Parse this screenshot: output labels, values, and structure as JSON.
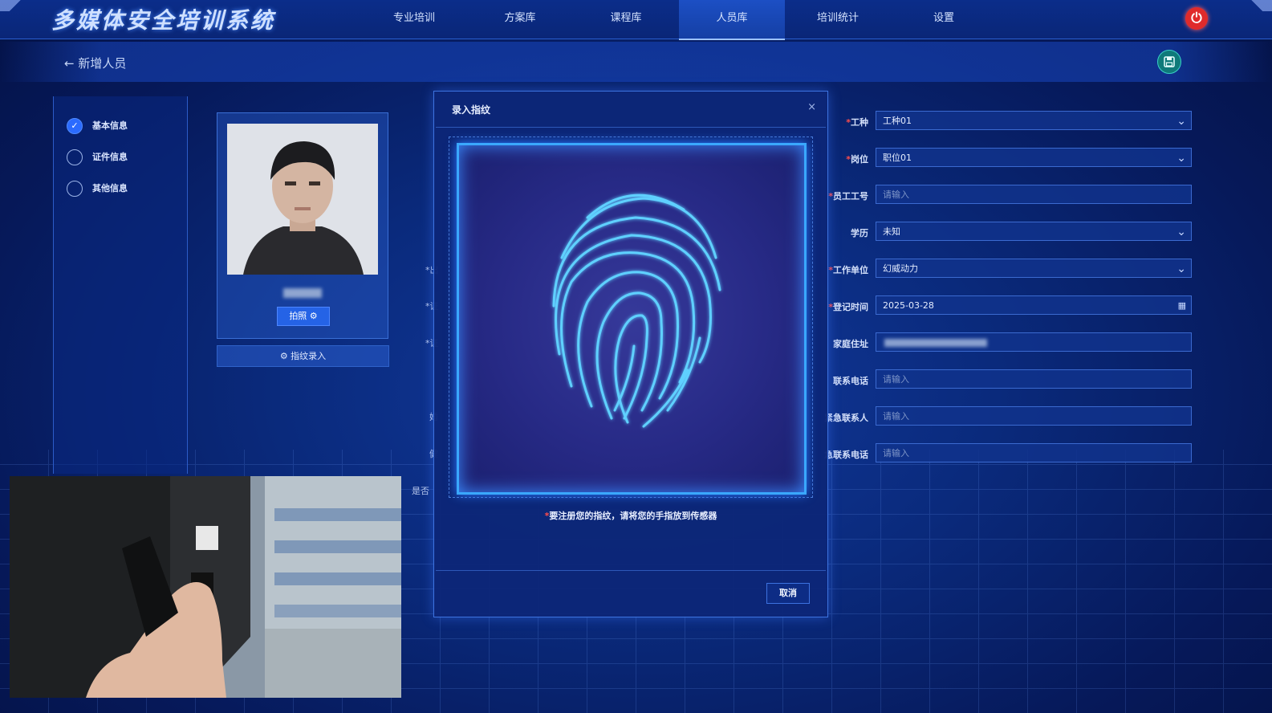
{
  "app": {
    "title": "多媒体安全培训系统"
  },
  "nav": {
    "items": [
      "专业培训",
      "方案库",
      "课程库",
      "人员库",
      "培训统计",
      "设置"
    ],
    "active_index": 3
  },
  "icons": {
    "power": "power-icon",
    "save": "save-icon",
    "back": "arrow-left-icon"
  },
  "page": {
    "back_label": "← 新增人员"
  },
  "steps": {
    "items": [
      {
        "label": "基本信息",
        "done": true
      },
      {
        "label": "证件信息",
        "done": false
      },
      {
        "label": "其他信息",
        "done": false
      }
    ]
  },
  "photo_card": {
    "shoot_label": "拍照 ⚙",
    "fingerprint_label": "⚙  指纹录入"
  },
  "hidden_labels": [
    "*出",
    "*证",
    "*证",
    "婚",
    "健",
    "是否"
  ],
  "form": {
    "fields": [
      {
        "label": "工种",
        "required": true,
        "value": "工种01",
        "type": "select"
      },
      {
        "label": "岗位",
        "required": true,
        "value": "职位01",
        "type": "select"
      },
      {
        "label": "员工工号",
        "required": true,
        "placeholder": "请输入",
        "type": "input"
      },
      {
        "label": "学历",
        "required": false,
        "value": "未知",
        "type": "select"
      },
      {
        "label": "工作单位",
        "required": true,
        "value": "幻威动力",
        "type": "select"
      },
      {
        "label": "登记时间",
        "required": true,
        "value": "2025-03-28",
        "type": "date"
      },
      {
        "label": "家庭住址",
        "required": false,
        "value": "",
        "type": "blurred"
      },
      {
        "label": "联系电话",
        "required": false,
        "placeholder": "请输入",
        "type": "input"
      },
      {
        "label": "紧急联系人",
        "required": false,
        "placeholder": "请输入",
        "type": "input"
      },
      {
        "label": "急联系电话",
        "required": false,
        "placeholder": "请输入",
        "type": "input"
      }
    ]
  },
  "modal": {
    "title": "录入指纹",
    "close": "×",
    "hint": "要注册您的指纹，请将您的手指放到传感器",
    "cancel_label": "取消"
  },
  "colors": {
    "accent": "#2b6bff",
    "power": "#e02b2b",
    "glow": "#3aa8ff"
  }
}
